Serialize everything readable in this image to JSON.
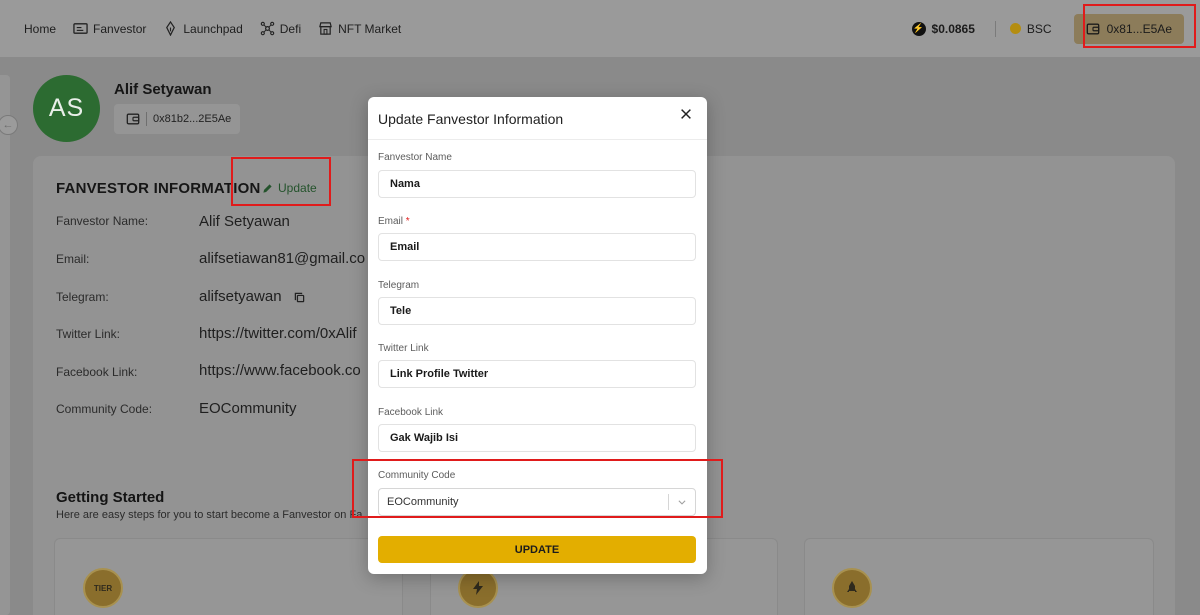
{
  "nav": {
    "items": [
      {
        "label": "Home",
        "icon": ""
      },
      {
        "label": "Fanvestor",
        "icon": "id-card-icon"
      },
      {
        "label": "Launchpad",
        "icon": "rocket-icon"
      },
      {
        "label": "Defi",
        "icon": "network-icon"
      },
      {
        "label": "NFT Market",
        "icon": "store-icon"
      }
    ],
    "price": "$0.0865",
    "chain": "BSC",
    "wallet": "0x81...E5Ae"
  },
  "profile": {
    "initials": "AS",
    "name": "Alif Setyawan",
    "wallet": "0x81b2...2E5Ae"
  },
  "info": {
    "title": "FANVESTOR INFORMATION",
    "update_label": "Update",
    "rows": [
      {
        "label": "Fanvestor Name:",
        "value": "Alif Setyawan"
      },
      {
        "label": "Email:",
        "value": "alifsetiawan81@gmail.co"
      },
      {
        "label": "Telegram:",
        "value": "alifsetyawan"
      },
      {
        "label": "Twitter Link:",
        "value": "https://twitter.com/0xAlif"
      },
      {
        "label": "Facebook Link:",
        "value": "https://www.facebook.co"
      },
      {
        "label": "Community Code:",
        "value": "EOCommunity"
      }
    ]
  },
  "getting_started": {
    "title": "Getting Started",
    "subtitle": "Here are easy steps for you to start become a Fanvestor on Fa",
    "tier_badge": "TIER"
  },
  "modal": {
    "title": "Update Fanvestor Information",
    "fields": [
      {
        "label": "Fanvestor Name",
        "value": "Nama",
        "required": false
      },
      {
        "label": "Email",
        "value": "Email",
        "required": true
      },
      {
        "label": "Telegram",
        "value": "Tele",
        "required": false
      },
      {
        "label": "Twitter Link",
        "value": "Link Profile Twitter",
        "required": false
      },
      {
        "label": "Facebook Link",
        "value": "Gak Wajib Isi",
        "required": false
      }
    ],
    "required_mark": "*",
    "community_label": "Community Code",
    "community_value": "EOCommunity",
    "submit_label": "UPDATE"
  },
  "colors": {
    "accent": "#e3ae00",
    "highlight": "#e01b1b",
    "avatar": "#2c6b31"
  }
}
